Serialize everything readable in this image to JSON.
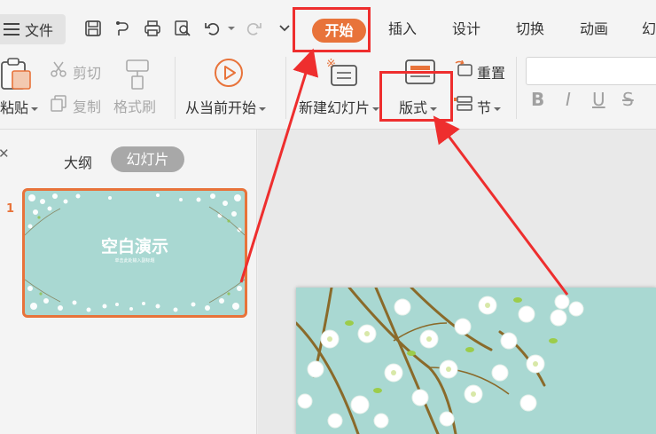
{
  "menubar": {
    "file_label": "文件",
    "tabs": [
      "开始",
      "插入",
      "设计",
      "切换",
      "动画",
      "幻"
    ]
  },
  "ribbon": {
    "paste_label": "粘贴",
    "cut_label": "剪切",
    "copy_label": "复制",
    "format_painter_label": "格式刷",
    "play_from_current_label": "从当前开始",
    "new_slide_label": "新建幻灯片",
    "layout_label": "版式",
    "reset_label": "重置",
    "section_label": "节",
    "format_buttons": [
      "B",
      "I",
      "U",
      "S"
    ]
  },
  "left_panel": {
    "outline_label": "大纲",
    "slides_label": "幻灯片",
    "slide_number": "1",
    "thumbnail_title": "空白演示",
    "thumbnail_subtitle": "单击此处输入副标题"
  },
  "colors": {
    "accent": "#e8733a",
    "annotation": "#ee2e2e",
    "slide_bg": "#a9d8d2"
  }
}
